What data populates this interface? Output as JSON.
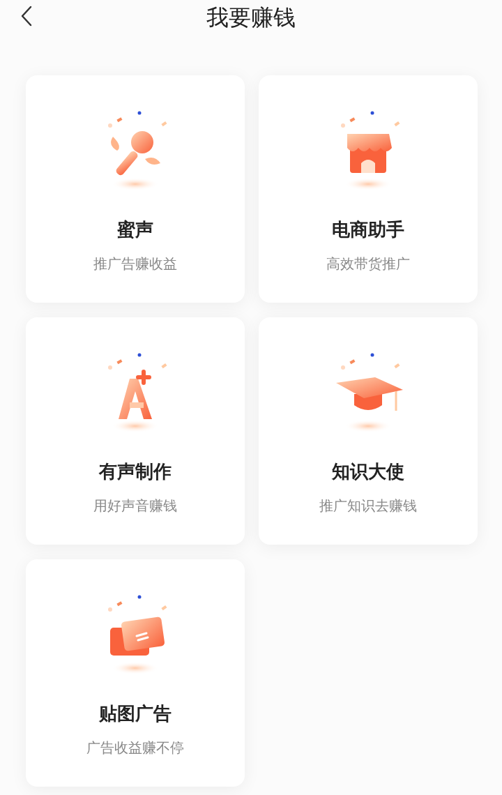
{
  "header": {
    "title": "我要赚钱"
  },
  "cards": [
    {
      "kind": "microphone",
      "title": "蜜声",
      "subtitle": "推广告赚收益"
    },
    {
      "kind": "store",
      "title": "电商助手",
      "subtitle": "高效带货推广"
    },
    {
      "kind": "letter",
      "title": "有声制作",
      "subtitle": "用好声音赚钱"
    },
    {
      "kind": "cap",
      "title": "知识大使",
      "subtitle": "推广知识去赚钱"
    },
    {
      "kind": "cards",
      "title": "贴图广告",
      "subtitle": "广告收益赚不停"
    }
  ]
}
